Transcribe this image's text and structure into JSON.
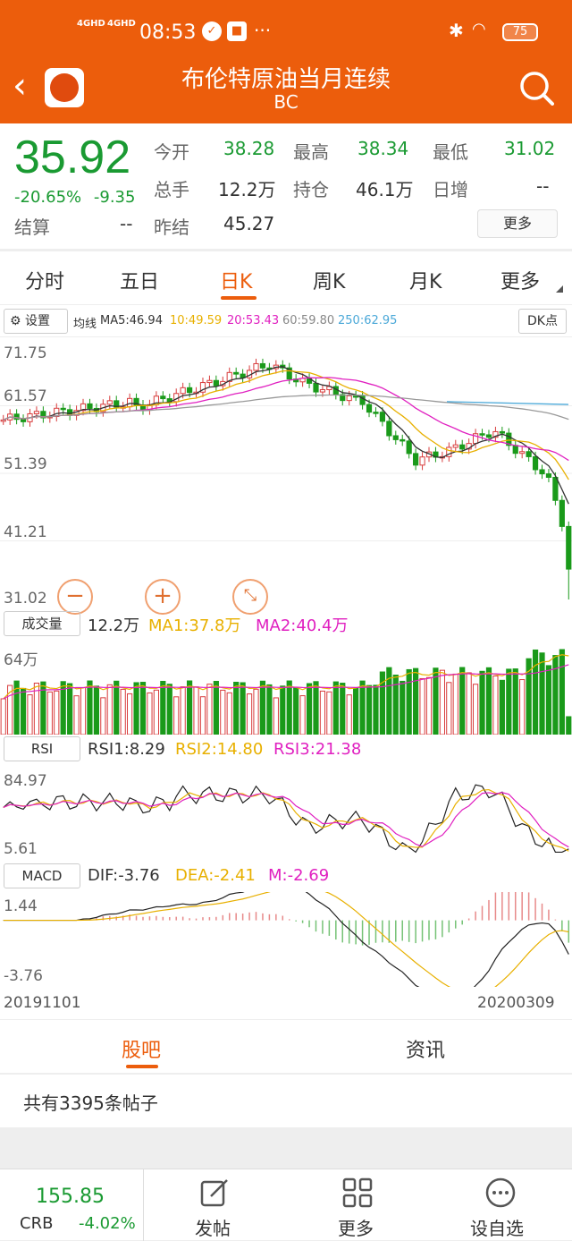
{
  "status_bar": {
    "net1": "4GHD",
    "net2": "4GHD",
    "time": "08:53",
    "more": "···",
    "battery": "75"
  },
  "header": {
    "title": "布伦特原油当月连续",
    "subtitle": "BC"
  },
  "quote": {
    "price": "35.92",
    "change_pct": "-20.65%",
    "change": "-9.35",
    "settle_label": "结算",
    "settle_value": "--",
    "rows": [
      [
        {
          "label": "今开",
          "value": "38.28"
        },
        {
          "label": "最高",
          "value": "38.34"
        },
        {
          "label": "最低",
          "value": "31.02"
        }
      ],
      [
        {
          "label": "总手",
          "value": "12.2万"
        },
        {
          "label": "持仓",
          "value": "46.1万"
        },
        {
          "label": "日增",
          "value": "--"
        }
      ],
      [
        {
          "label": "昨结",
          "value": "45.27"
        }
      ]
    ],
    "more_label": "更多"
  },
  "tabs": {
    "items": [
      "分时",
      "五日",
      "日K",
      "周K",
      "月K",
      "更多"
    ],
    "active": "日K"
  },
  "ma_bar": {
    "settings_label": "设置",
    "prefix": "均线",
    "ma5": "MA5:46.94",
    "ma10": "10:49.59",
    "ma20": "20:53.43",
    "ma60": "60:59.80",
    "ma250": "250:62.95",
    "dk_label": "DK点",
    "colors": {
      "ma5": "#333333",
      "ma10": "#e8b000",
      "ma20": "#e020c0",
      "ma60": "#888888",
      "ma250": "#4aa8d8"
    }
  },
  "kline": {
    "y_labels": [
      "71.75",
      "61.57",
      "51.39",
      "41.21",
      "31.02"
    ]
  },
  "volume": {
    "label": "成交量",
    "value": "12.2万",
    "ma1": "MA1:37.8万",
    "ma2": "MA2:40.4万",
    "top_label": "64万"
  },
  "rsi": {
    "label": "RSI",
    "rsi1": "RSI1:8.29",
    "rsi2": "RSI2:14.80",
    "rsi3": "RSI3:21.38",
    "top": "84.97",
    "bottom": "5.61"
  },
  "macd": {
    "label": "MACD",
    "dif": "DIF:-3.76",
    "dea": "DEA:-2.41",
    "m": "M:-2.69",
    "top": "1.44",
    "bottom": "-3.76"
  },
  "date_axis": {
    "start": "20191101",
    "end": "20200309"
  },
  "bottom_tabs": {
    "items": [
      "股吧",
      "资讯"
    ],
    "active": "股吧"
  },
  "posts": {
    "summary": "共有3395条帖子"
  },
  "footer": {
    "price": "155.85",
    "code": "CRB",
    "change": "-4.02%",
    "items": [
      {
        "label": "发帖",
        "icon": "edit-icon"
      },
      {
        "label": "更多",
        "icon": "grid-icon"
      },
      {
        "label": "设自选",
        "icon": "more-circle-icon"
      }
    ]
  }
}
